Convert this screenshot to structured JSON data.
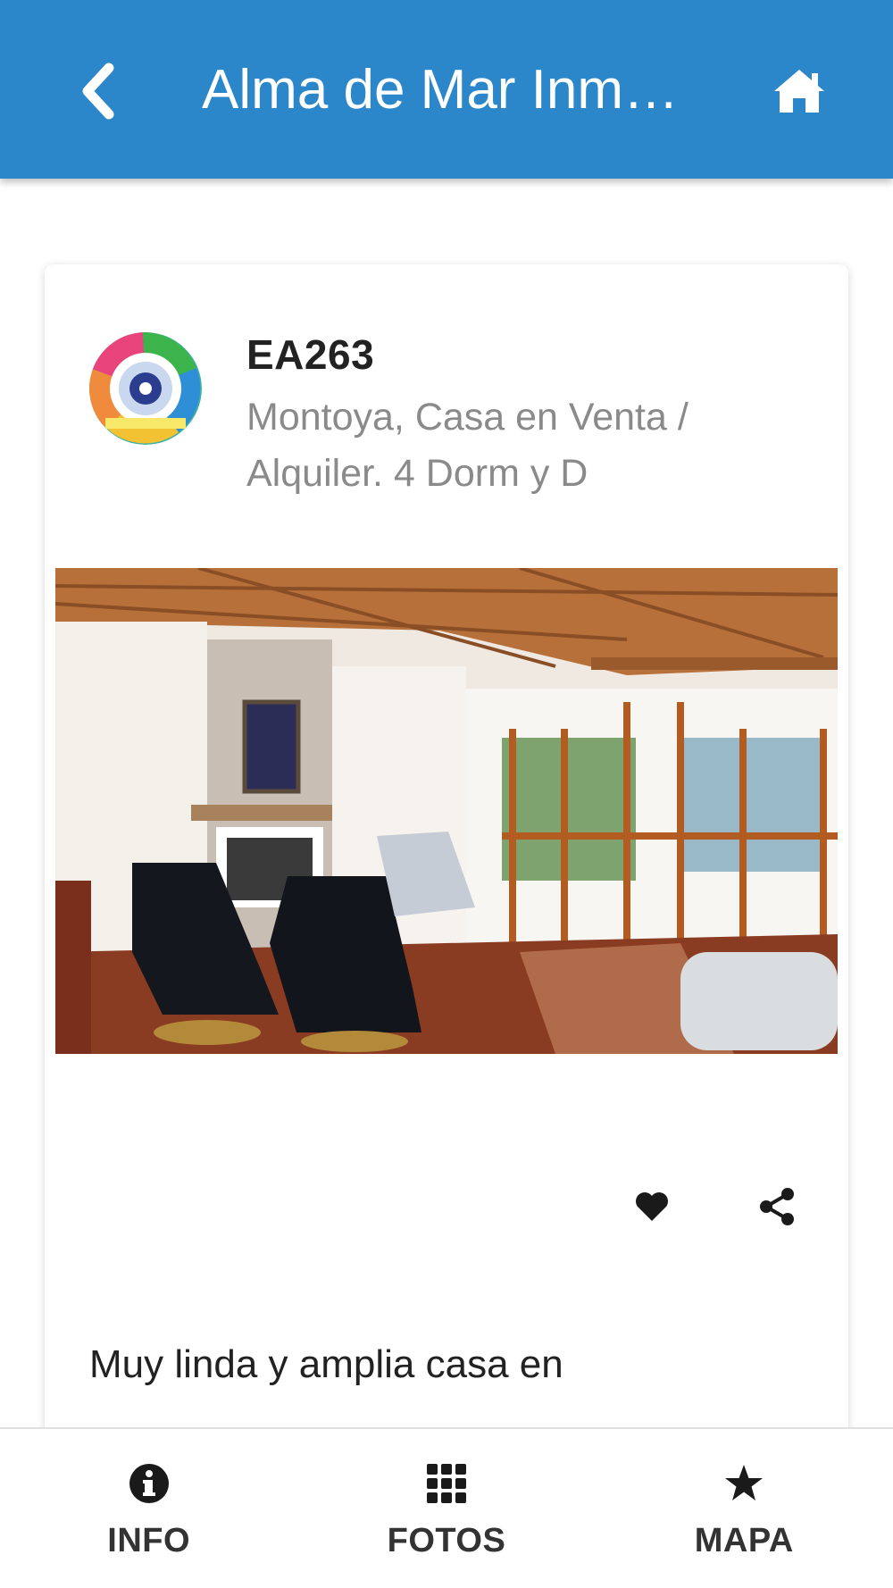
{
  "colors": {
    "app_bar": "#2b87c9",
    "text_primary": "#222222",
    "text_secondary": "#8a8a8a",
    "nav_label": "#333333"
  },
  "header": {
    "title": "Alma de Mar Inm…",
    "back_icon": "chevron-left-icon",
    "home_icon": "home-icon"
  },
  "listing": {
    "code": "EA263",
    "subtitle": "Montoya, Casa en Venta / Alquiler. 4 Dorm y D",
    "avatar": "agency-logo",
    "photo": "living-room-photo",
    "favorite_icon": "heart-icon",
    "share_icon": "share-icon",
    "description": "Muy linda y amplia casa en"
  },
  "bottom_nav": {
    "items": [
      {
        "label": "INFO",
        "icon": "info-icon"
      },
      {
        "label": "FOTOS",
        "icon": "grid-icon"
      },
      {
        "label": "MAPA",
        "icon": "star-icon"
      }
    ]
  }
}
